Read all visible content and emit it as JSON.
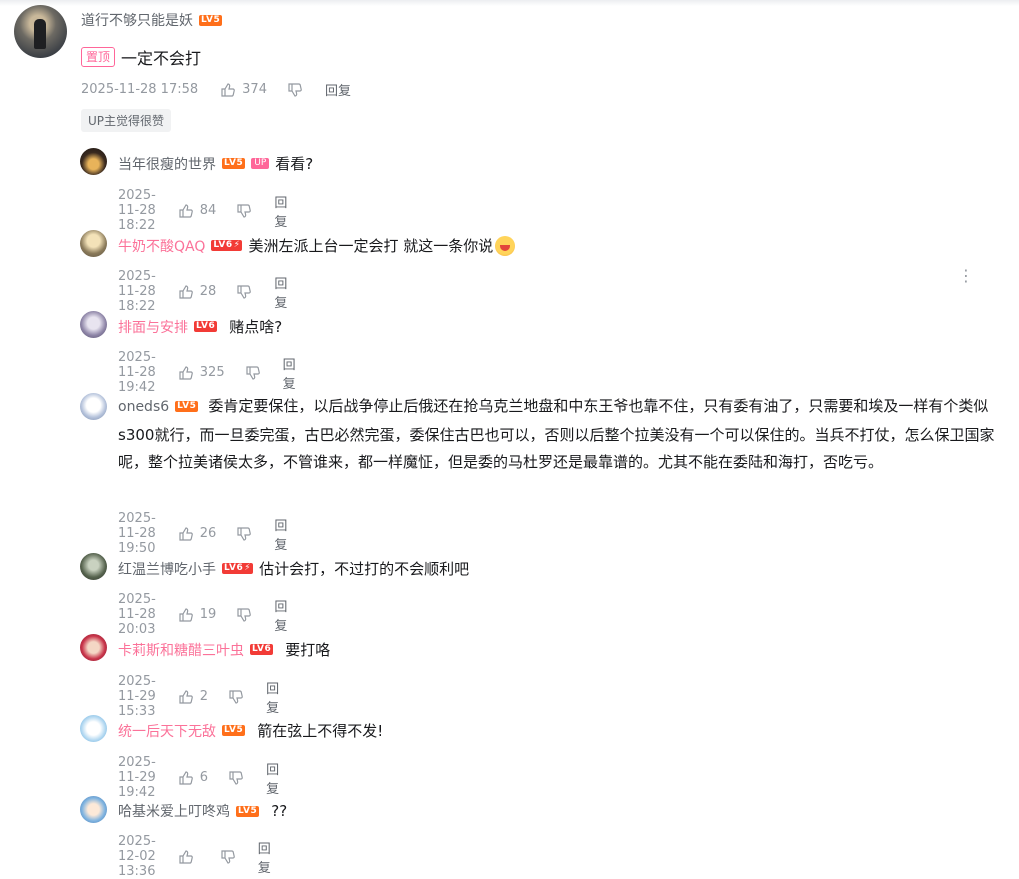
{
  "root": {
    "username": "道行不够只能是妖",
    "level": "LV5",
    "pin_label": "置顶",
    "content": "一定不会打",
    "time": "2025-11-28 17:58",
    "likes": "374",
    "reply_label": "回复",
    "up_tag": "UP主觉得很赞"
  },
  "replies": [
    {
      "username": "当年很瘦的世界",
      "level": "LV5",
      "up_badge": "UP",
      "content": "看看?",
      "time": "2025-11-28 18:22",
      "likes": "84",
      "reply_label": "回复"
    },
    {
      "username": "牛奶不酸QAQ",
      "level": "LV6",
      "content": "美洲左派上台一定会打 就这一条你说",
      "time": "2025-11-28 18:22",
      "likes": "28",
      "reply_label": "回复"
    },
    {
      "username": "排面与安排",
      "level": "LV6",
      "content": "赌点啥?",
      "time": "2025-11-28 19:42",
      "likes": "325",
      "reply_label": "回复"
    },
    {
      "username": "oneds6",
      "level": "LV5",
      "content": "委肯定要保住，以后战争停止后俄还在抢乌克兰地盘和中东王爷也靠不住，只有委有油了，只需要和埃及一样有个类似s300就行，而一旦委完蛋，古巴必然完蛋，委保住古巴也可以，否则以后整个拉美没有一个可以保住的。当兵不打仗，怎么保卫国家呢，整个拉美诸侯太多，不管谁来，都一样魔怔，但是委的马杜罗还是最靠谱的。尤其不能在委陆和海打，否吃亏。",
      "time": "2025-11-28 19:50",
      "likes": "26",
      "reply_label": "回复"
    },
    {
      "username": "红温兰博吃小手",
      "level": "LV6",
      "content": "估计会打，不过打的不会顺利吧",
      "time": "2025-11-28 20:03",
      "likes": "19",
      "reply_label": "回复"
    },
    {
      "username": "卡莉斯和糖醋三叶虫",
      "level": "LV6",
      "content": "要打咯",
      "time": "2025-11-29 15:33",
      "likes": "2",
      "reply_label": "回复"
    },
    {
      "username": "统一后天下无敌",
      "level": "LV5",
      "content": "箭在弦上不得不发!",
      "time": "2025-11-29 19:42",
      "likes": "6",
      "reply_label": "回复"
    },
    {
      "username": "哈基米爱上叮咚鸡",
      "level": "LV5",
      "content": "??",
      "time": "2025-12-02 13:36",
      "likes": "",
      "reply_label": "回复"
    }
  ],
  "colors": {
    "pink": "#fb7299",
    "gray_text": "#9499a0",
    "lv5": "#ff6f1a",
    "lv6": "#f23b36"
  }
}
